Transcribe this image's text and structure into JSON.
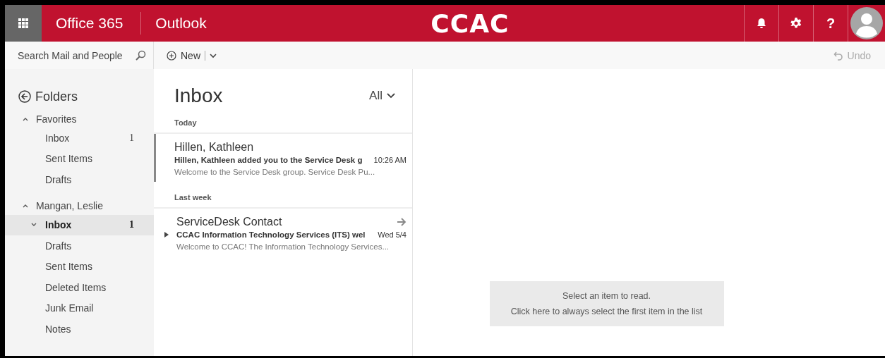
{
  "header": {
    "app_suite": "Office 365",
    "app_name": "Outlook",
    "logo": "CCAC",
    "help": "?"
  },
  "search": {
    "placeholder": "Search Mail and People"
  },
  "toolbar": {
    "new_label": "New",
    "undo_label": "Undo"
  },
  "folders": {
    "title": "Folders",
    "groups": [
      {
        "name": "Favorites",
        "expanded": true,
        "items": [
          {
            "name": "Inbox",
            "count": "1",
            "selected": false,
            "has_subfolders": false
          },
          {
            "name": "Sent Items",
            "selected": false,
            "has_subfolders": false
          },
          {
            "name": "Drafts",
            "selected": false,
            "has_subfolders": false
          }
        ]
      },
      {
        "name": "Mangan, Leslie",
        "expanded": true,
        "items": [
          {
            "name": "Inbox",
            "count": "1",
            "selected": true,
            "has_subfolders": true
          },
          {
            "name": "Drafts",
            "selected": false,
            "has_subfolders": false
          },
          {
            "name": "Sent Items",
            "selected": false,
            "has_subfolders": false
          },
          {
            "name": "Deleted Items",
            "selected": false,
            "has_subfolders": false
          },
          {
            "name": "Junk Email",
            "selected": false,
            "has_subfolders": false
          },
          {
            "name": "Notes",
            "selected": false,
            "has_subfolders": false
          }
        ]
      }
    ]
  },
  "message_list": {
    "title": "Inbox",
    "filter": "All",
    "sections": [
      {
        "label": "Today",
        "messages": [
          {
            "sender": "Hillen, Kathleen",
            "subject": "Hillen, Kathleen added you to the Service Desk g",
            "time": "10:26 AM",
            "preview": "Welcome to the Service Desk group.     Service Desk Pu...",
            "selected": true,
            "forwarded": false,
            "thread": false
          }
        ]
      },
      {
        "label": "Last week",
        "messages": [
          {
            "sender": "ServiceDesk Contact",
            "subject": "CCAC Information Technology Services (ITS) wel",
            "time": "Wed 5/4",
            "preview": "Welcome to CCAC! The Information Technology Services...",
            "selected": false,
            "forwarded": true,
            "thread": true
          }
        ]
      }
    ]
  },
  "reading_pane": {
    "line_1": "Select an item to read.",
    "line_2": "Click here to always select the first item in the list"
  }
}
